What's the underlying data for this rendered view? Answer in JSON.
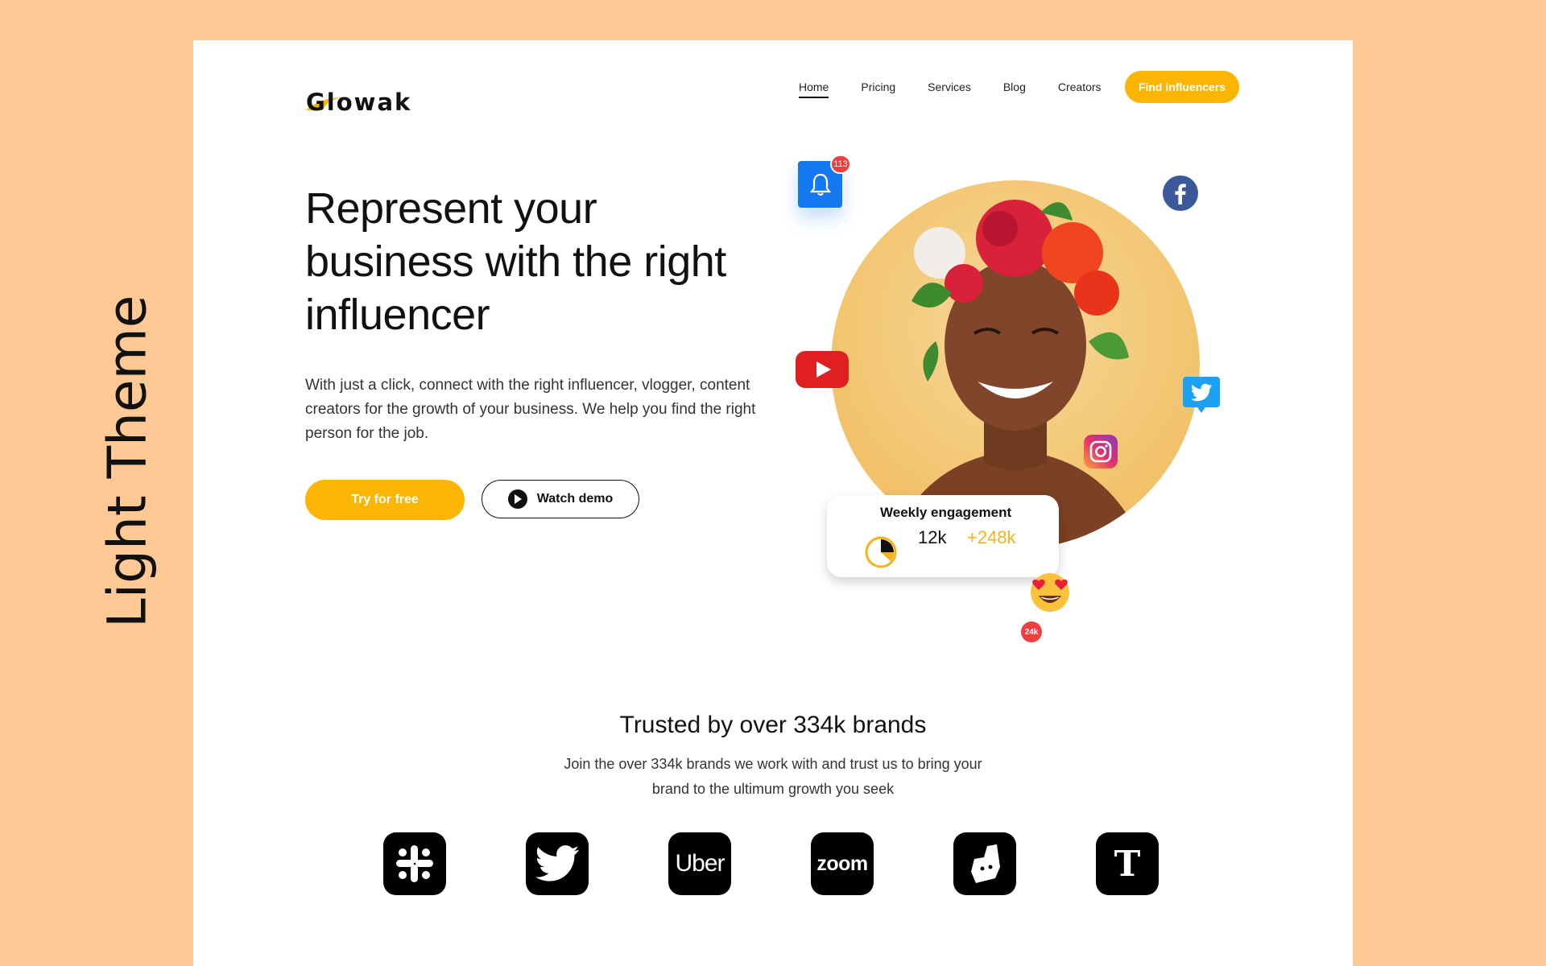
{
  "side_label": "Light Theme",
  "logo": {
    "text": "Glowak"
  },
  "nav": {
    "items": [
      {
        "label": "Home",
        "active": true
      },
      {
        "label": "Pricing",
        "active": false
      },
      {
        "label": "Services",
        "active": false
      },
      {
        "label": "Blog",
        "active": false
      },
      {
        "label": "Creators",
        "active": false
      }
    ],
    "cta": "Find influencers"
  },
  "hero": {
    "title_lines": [
      "Represent your",
      "business with the right",
      "influencer"
    ],
    "description": "With just a click, connect with the right influencer, vlogger, content creators for the growth of your business. We help you find the right person for the job.",
    "try_button": "Try for free",
    "demo_button": "Watch demo"
  },
  "illustration": {
    "notification_count": "113",
    "engagement": {
      "title": "Weekly engagement",
      "value": "12k",
      "delta": "+248k"
    },
    "reaction_count": "24k"
  },
  "trust": {
    "title": "Trusted by over 334k brands",
    "description": "Join the over 334k brands we work with and trust us to bring your brand to the ultimum growth you seek",
    "brands": [
      "slack-icon",
      "twitter-icon",
      "uber-icon",
      "zoom-icon",
      "deliveroo-icon",
      "nytimes-icon"
    ],
    "brand_text": {
      "uber": "Uber",
      "zoom": "zoom",
      "nytimes": "T"
    }
  },
  "colors": {
    "accent": "#FDB504",
    "background": "#FEC994",
    "blue": "#1478F0",
    "red": "#F03E3E"
  }
}
